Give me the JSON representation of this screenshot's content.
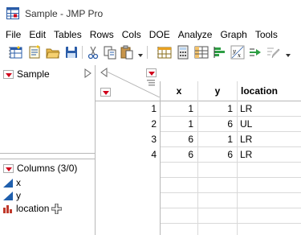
{
  "window": {
    "title": "Sample - JMP Pro"
  },
  "menu": [
    "File",
    "Edit",
    "Tables",
    "Rows",
    "Cols",
    "DOE",
    "Analyze",
    "Graph",
    "Tools"
  ],
  "toolbar_icons": [
    "new-data-table-icon",
    "new-script-icon",
    "open-icon",
    "save-icon",
    "cut-icon",
    "copy-icon",
    "paste-icon",
    "data-grid-icon",
    "calculator-icon",
    "tabulate-icon",
    "distribution-icon",
    "fit-y-by-x-icon",
    "fit-model-icon",
    "pen-icon"
  ],
  "left_panel": {
    "table_name": "Sample",
    "columns_header": "Columns (3/0)",
    "columns": [
      {
        "name": "x",
        "type": "continuous"
      },
      {
        "name": "y",
        "type": "continuous"
      },
      {
        "name": "location",
        "type": "nominal"
      }
    ]
  },
  "grid": {
    "headers": [
      "x",
      "y",
      "location"
    ],
    "rows": [
      {
        "n": "1",
        "x": "1",
        "y": "1",
        "location": "LR"
      },
      {
        "n": "2",
        "x": "1",
        "y": "6",
        "location": "UL"
      },
      {
        "n": "3",
        "x": "6",
        "y": "1",
        "location": "LR"
      },
      {
        "n": "4",
        "x": "6",
        "y": "6",
        "location": "LR"
      }
    ]
  },
  "colors": {
    "accent_red": "#d0021b",
    "continuous_blue": "#1f5fad",
    "nominal_red": "#c0392b"
  }
}
